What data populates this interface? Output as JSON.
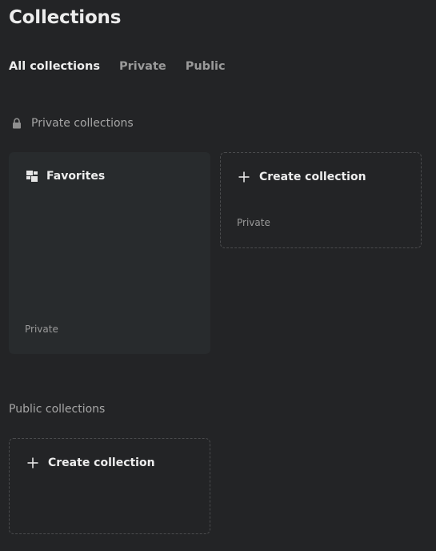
{
  "page": {
    "title": "Collections"
  },
  "tabs": [
    {
      "label": "All collections",
      "active": true
    },
    {
      "label": "Private",
      "active": false
    },
    {
      "label": "Public",
      "active": false
    }
  ],
  "sections": {
    "private": {
      "heading": "Private collections",
      "icon": "lock-icon",
      "cards": {
        "favorites": {
          "title": "Favorites",
          "icon": "favorites-grid-icon",
          "visibility": "Private"
        },
        "create": {
          "label": "Create collection",
          "icon": "plus-icon",
          "visibility": "Private"
        }
      }
    },
    "public": {
      "heading": "Public collections",
      "cards": {
        "create": {
          "label": "Create collection",
          "icon": "plus-icon"
        }
      }
    }
  },
  "colors": {
    "background": "#232426",
    "card_background": "#282b2d",
    "text_primary": "#ececec",
    "text_muted": "#9a9a9a"
  }
}
